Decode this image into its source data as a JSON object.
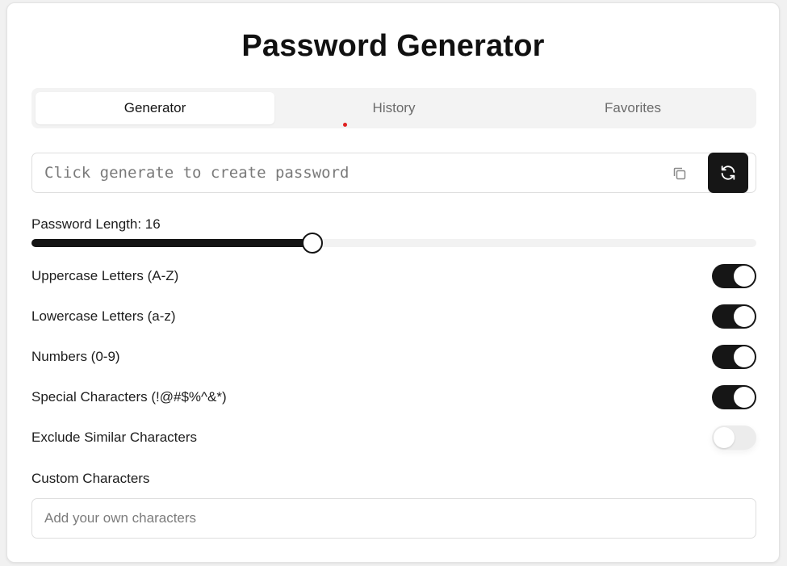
{
  "app": {
    "title": "Password Generator"
  },
  "tabs": [
    {
      "label": "Generator",
      "active": true
    },
    {
      "label": "History",
      "active": false
    },
    {
      "label": "Favorites",
      "active": false
    }
  ],
  "password": {
    "value": "",
    "placeholder": "Click generate to create password",
    "copy_icon": "copy-icon",
    "generate_icon": "refresh-icon"
  },
  "length": {
    "label": "Password Length: 16",
    "value": 16,
    "fill_fraction": 0.387
  },
  "options": [
    {
      "label": "Uppercase Letters (A-Z)",
      "enabled": true
    },
    {
      "label": "Lowercase Letters (a-z)",
      "enabled": true
    },
    {
      "label": "Numbers (0-9)",
      "enabled": true
    },
    {
      "label": "Special Characters (!@#$%^&*)",
      "enabled": true
    },
    {
      "label": "Exclude Similar Characters",
      "enabled": false
    }
  ],
  "custom": {
    "label": "Custom Characters",
    "placeholder": "Add your own characters",
    "value": ""
  },
  "colors": {
    "accent": "#161616",
    "toggle_off": "#ececec",
    "indicator_dot": "#e02020"
  }
}
